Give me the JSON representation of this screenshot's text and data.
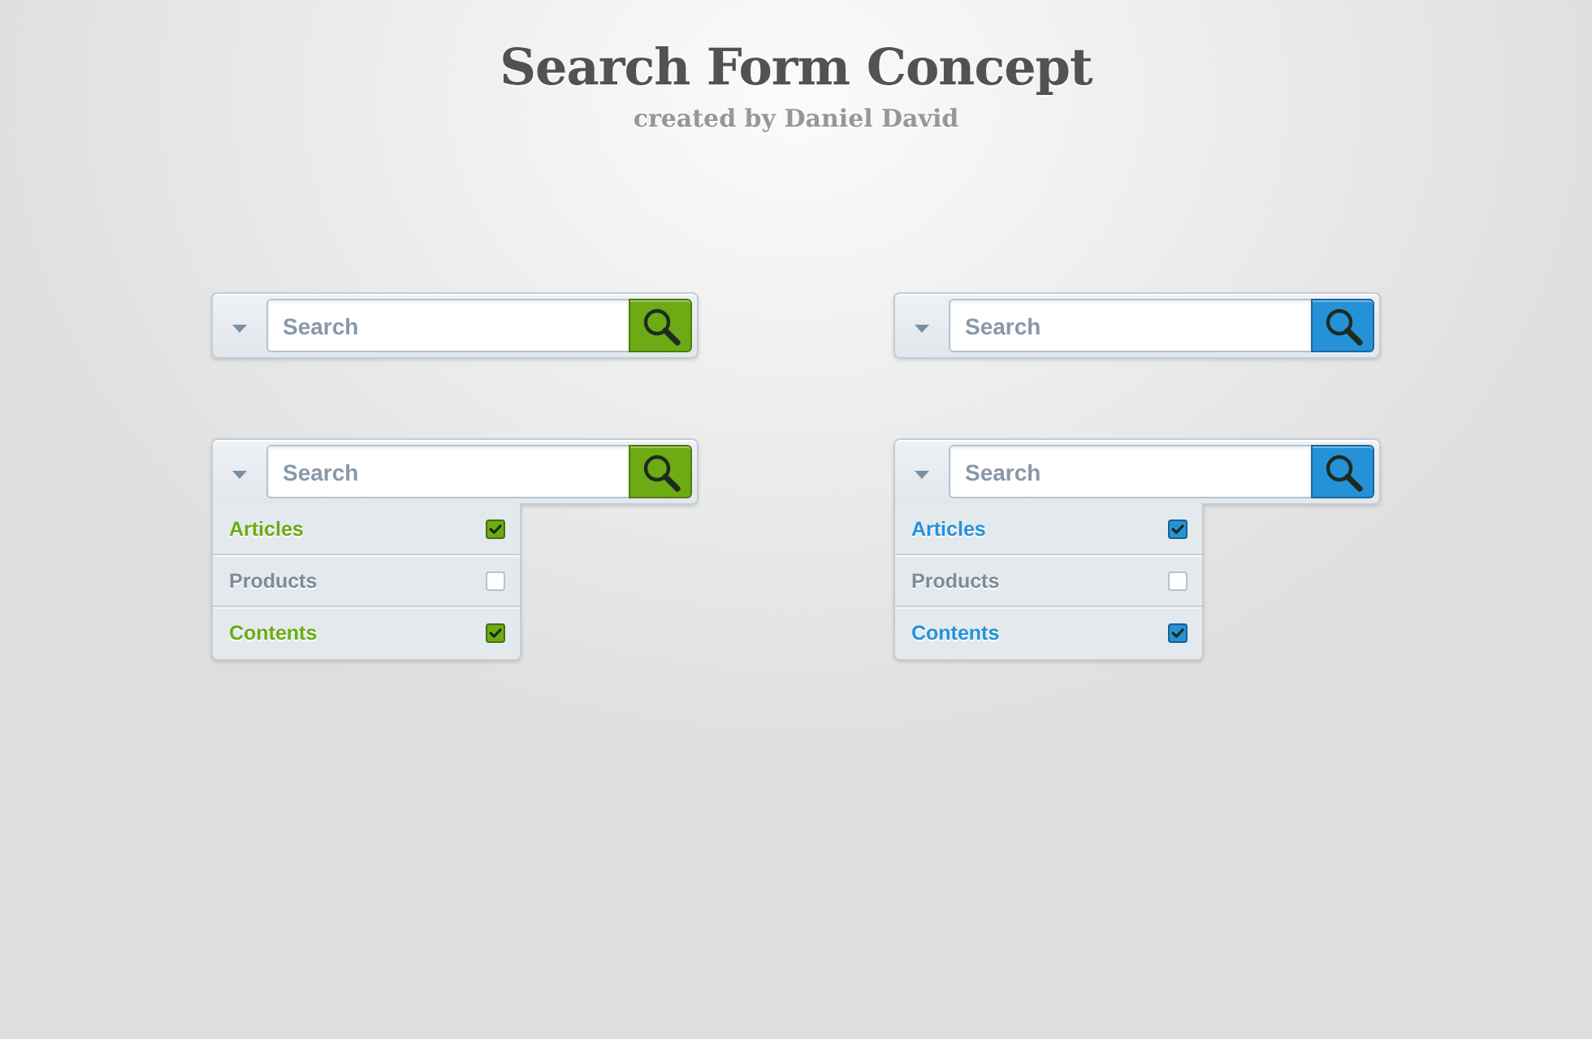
{
  "header": {
    "title": "Search Form Concept",
    "subtitle": "created by Daniel David"
  },
  "forms": [
    {
      "color": "#6cab14",
      "placeholder": "Search",
      "expanded": false
    },
    {
      "color": "#2592d8",
      "placeholder": "Search",
      "expanded": false
    },
    {
      "color": "#6cab14",
      "placeholder": "Search",
      "expanded": true,
      "options": [
        {
          "label": "Articles",
          "checked": true
        },
        {
          "label": "Products",
          "checked": false
        },
        {
          "label": "Contents",
          "checked": true
        }
      ]
    },
    {
      "color": "#2592d8",
      "placeholder": "Search",
      "expanded": true,
      "options": [
        {
          "label": "Articles",
          "checked": true
        },
        {
          "label": "Products",
          "checked": false
        },
        {
          "label": "Contents",
          "checked": true
        }
      ]
    }
  ]
}
